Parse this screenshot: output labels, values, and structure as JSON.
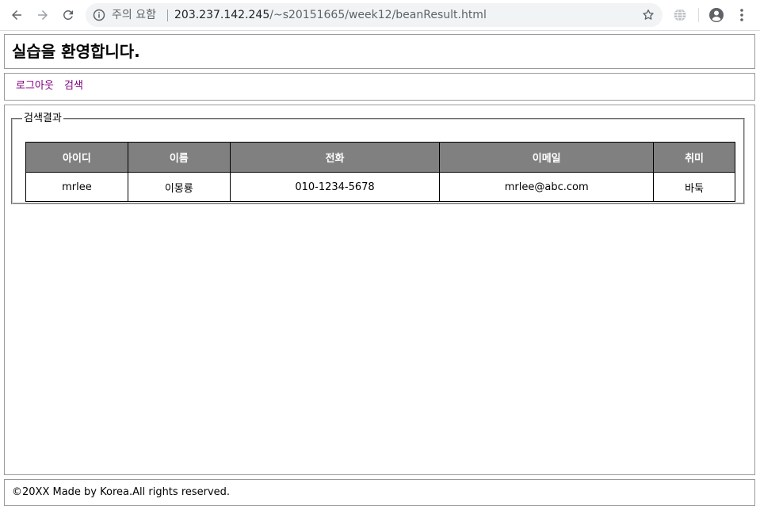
{
  "browser": {
    "security_label": "주의 요함",
    "url_host": "203.237.142.245",
    "url_path": "/~s20151665/week12/beanResult.html"
  },
  "header": {
    "title": "실습을 환영합니다."
  },
  "nav": {
    "logout": "로그아웃",
    "search": "검색"
  },
  "result": {
    "legend": "검색결과",
    "columns": [
      "아이디",
      "이름",
      "전화",
      "이메일",
      "취미"
    ],
    "rows": [
      [
        "mrlee",
        "이몽룡",
        "010-1234-5678",
        "mrlee@abc.com",
        "바둑"
      ]
    ]
  },
  "footer": {
    "text": "©20XX Made by Korea.All rights reserved."
  }
}
